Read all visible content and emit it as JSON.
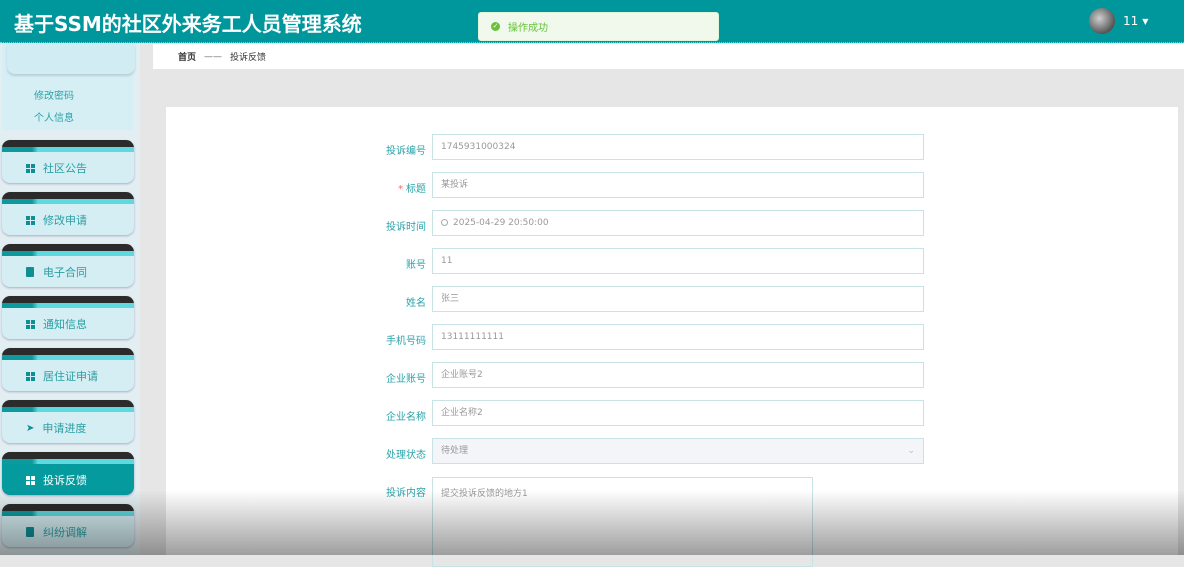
{
  "header": {
    "title": "基于SSM的社区外来务工人员管理系统",
    "username": "11"
  },
  "toast": {
    "message": "操作成功"
  },
  "sidebar": {
    "sub_links": [
      "修改密码",
      "个人信息"
    ],
    "items": [
      {
        "label": "社区公告",
        "icon": "grid"
      },
      {
        "label": "修改申请",
        "icon": "grid"
      },
      {
        "label": "电子合同",
        "icon": "clipboard"
      },
      {
        "label": "通知信息",
        "icon": "grid"
      },
      {
        "label": "居住证申请",
        "icon": "grid"
      },
      {
        "label": "申请进度",
        "icon": "send"
      },
      {
        "label": "投诉反馈",
        "icon": "grid",
        "active": true
      },
      {
        "label": "纠纷调解",
        "icon": "clipboard"
      }
    ]
  },
  "breadcrumb": {
    "home": "首页",
    "separator": "——",
    "current": "投诉反馈"
  },
  "form": {
    "fields": [
      {
        "label": "投诉编号",
        "value": "1745931000324"
      },
      {
        "label": "标题",
        "value": "某投诉",
        "required": "*"
      },
      {
        "label": "投诉时间",
        "value": "2025-04-29 20:50:00"
      },
      {
        "label": "账号",
        "value": "11"
      },
      {
        "label": "姓名",
        "value": "张三"
      },
      {
        "label": "手机号码",
        "value": "13111111111"
      },
      {
        "label": "企业账号",
        "value": "企业账号2"
      },
      {
        "label": "企业名称",
        "value": "企业名称2"
      },
      {
        "label": "处理状态",
        "value": "待处理"
      }
    ],
    "content_label": "投诉内容",
    "content_value": "提交投诉反馈的地方1"
  }
}
